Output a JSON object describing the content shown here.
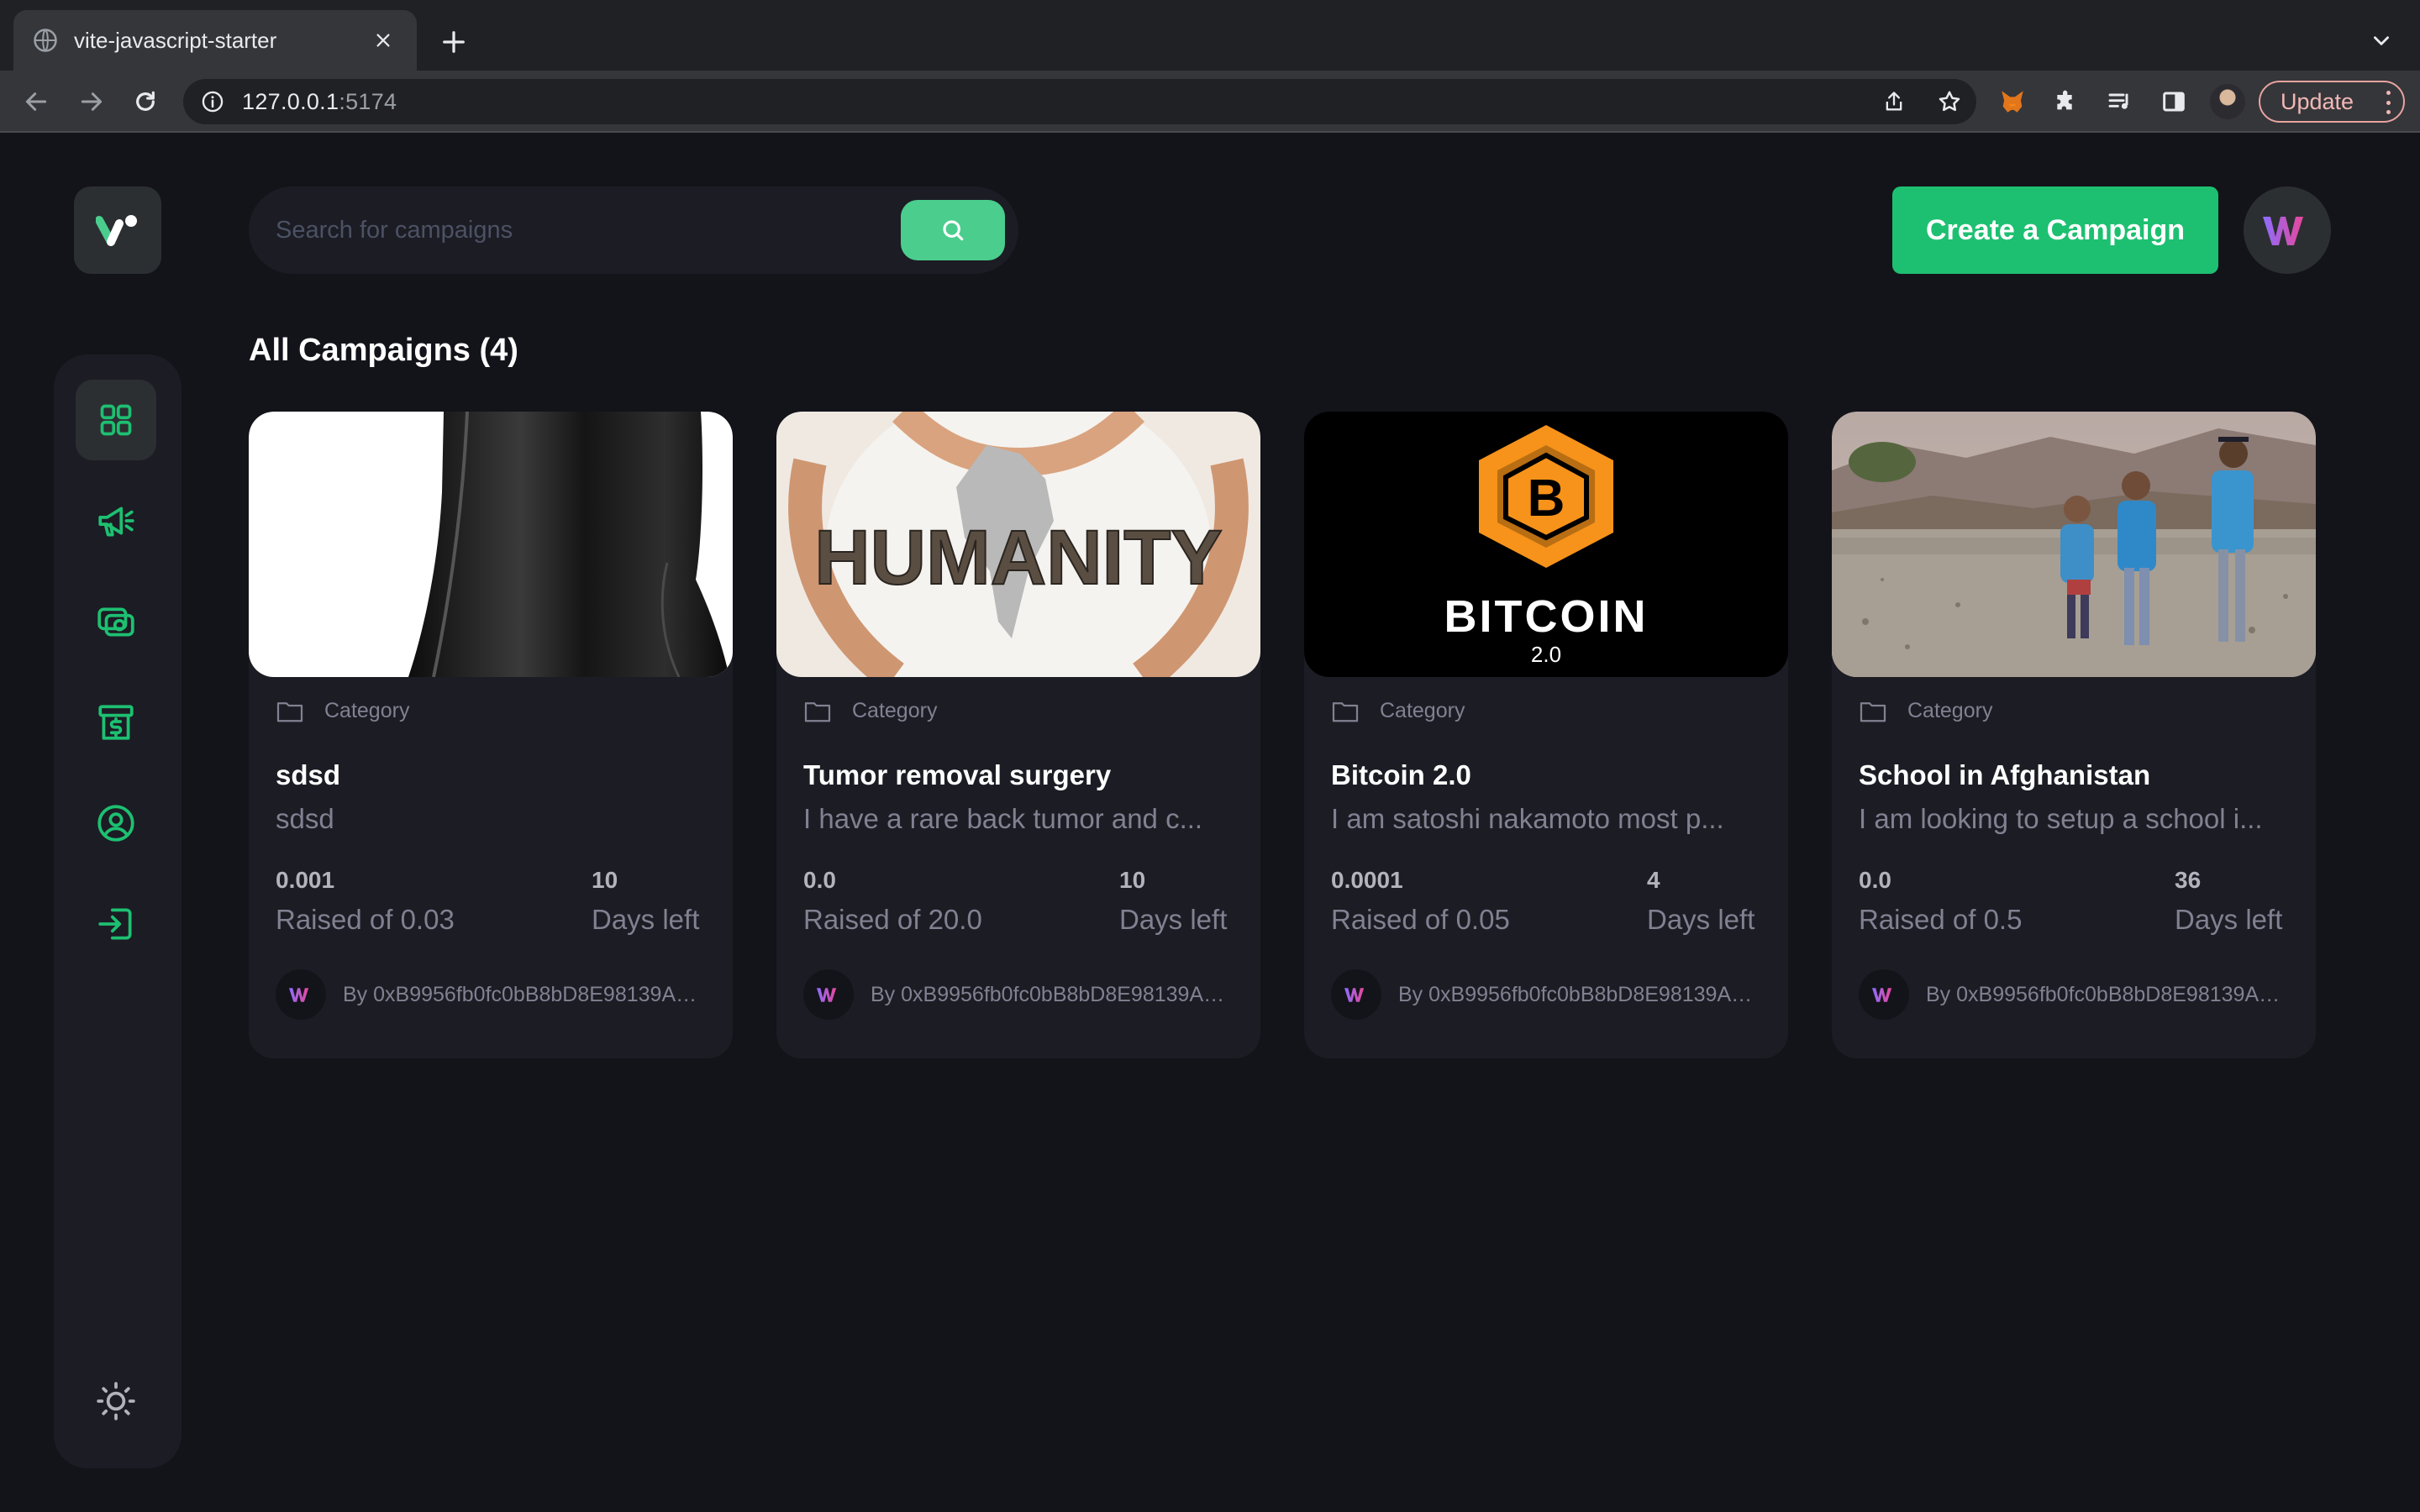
{
  "browser": {
    "tab_title": "vite-javascript-starter",
    "url_host": "127.0.0.1",
    "url_port": ":5174",
    "update_label": "Update"
  },
  "search": {
    "placeholder": "Search for campaigns"
  },
  "header": {
    "create_label": "Create a Campaign"
  },
  "page": {
    "heading": "All Campaigns (4)"
  },
  "colors": {
    "accent": "#1dc071",
    "accent_light": "#4acd8d",
    "bg": "#13131a",
    "card": "#1c1c24",
    "muted": "#808191"
  },
  "sidebar": {
    "items": [
      {
        "icon": "dashboard-icon",
        "active": true
      },
      {
        "icon": "megaphone-icon",
        "active": false
      },
      {
        "icon": "payment-icon",
        "active": false
      },
      {
        "icon": "withdraw-icon",
        "active": false
      },
      {
        "icon": "profile-icon",
        "active": false
      },
      {
        "icon": "logout-icon",
        "active": false
      }
    ],
    "theme_icon": "sun-icon"
  },
  "campaigns": [
    {
      "category": "Category",
      "title": "sdsd",
      "description": "sdsd",
      "raised": "0.001",
      "raised_label": "Raised of 0.03",
      "days": "10",
      "days_label": "Days left",
      "owner": "By 0xB9956fb0fc0bB8bD8E98139AC..."
    },
    {
      "category": "Category",
      "title": "Tumor removal surgery",
      "description": "I have a rare back tumor and c...",
      "raised": "0.0",
      "raised_label": "Raised of 20.0",
      "days": "10",
      "days_label": "Days left",
      "owner": "By 0xB9956fb0fc0bB8bD8E98139AC...",
      "image_text": "HUMANITY"
    },
    {
      "category": "Category",
      "title": "Bitcoin 2.0",
      "description": "I am satoshi nakamoto most p...",
      "raised": "0.0001",
      "raised_label": "Raised of 0.05",
      "days": "4",
      "days_label": "Days left",
      "owner": "By 0xB9956fb0fc0bB8bD8E98139AC...",
      "image_text": "BITCOIN",
      "image_subtext": "2.0"
    },
    {
      "category": "Category",
      "title": "School in Afghanistan",
      "description": "I am looking to setup a school i...",
      "raised": "0.0",
      "raised_label": "Raised of 0.5",
      "days": "36",
      "days_label": "Days left",
      "owner": "By 0xB9956fb0fc0bB8bD8E98139AC..."
    }
  ]
}
